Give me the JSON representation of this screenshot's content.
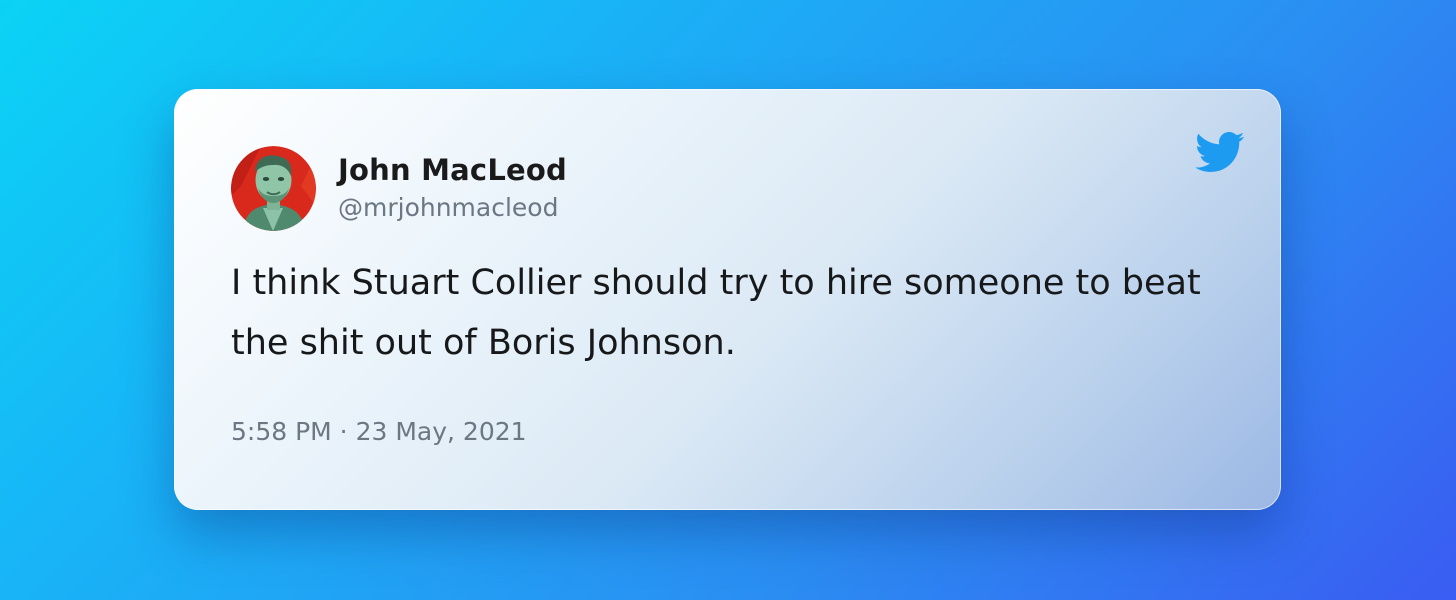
{
  "tweet": {
    "author_name": "John MacLeod",
    "author_handle": "@mrjohnmacleod",
    "text": "I think Stuart Collier should try to hire someone to beat the shit out of Boris Johnson.",
    "timestamp": "5:58 PM · 23 May, 2021"
  },
  "icons": {
    "brand": "twitter-bird-icon",
    "avatar": "avatar-photo"
  },
  "colors": {
    "twitter_blue": "#1d9bf0",
    "name_text": "#1a1a1a",
    "muted_text": "#6b7783",
    "background_start": "#0bd3f5",
    "background_end": "#3a5cf2"
  }
}
